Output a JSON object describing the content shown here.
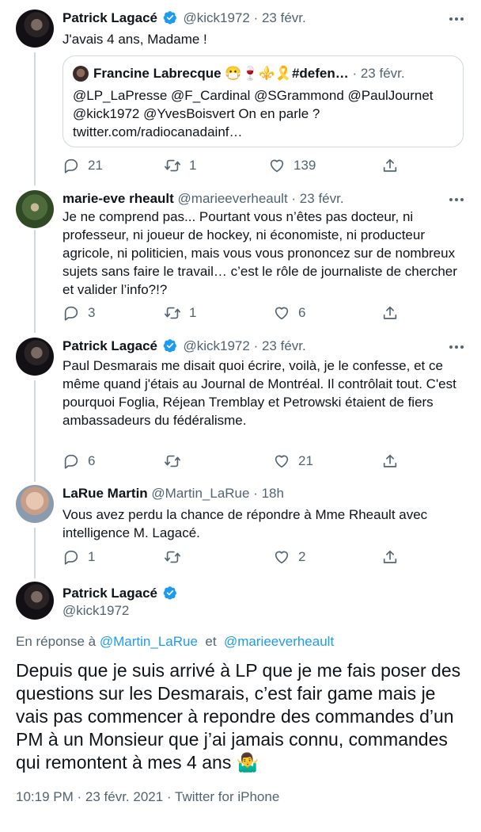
{
  "colors": {
    "accent": "#1d9bf0",
    "muted": "#536471",
    "text": "#0f1419",
    "border": "#cfd9de"
  },
  "tweets": [
    {
      "name": "Patrick Lagacé",
      "handle": "@kick1972",
      "date": "· 23 févr.",
      "verified": true,
      "text": "J'avais 4 ans, Madame !",
      "quote": {
        "name": "Francine Labrecque 😷🍷⚜️🎗️#defen…",
        "date": "· 23 févr.",
        "text": "@LP_LaPresse @F_Cardinal @SGrammond @PaulJournet @kick1972 @YvesBoisvert On en parle ? twitter.com/radiocanadainf…"
      },
      "replies": "21",
      "retweets": "1",
      "likes": "139"
    },
    {
      "name": "marie-eve rheault",
      "handle": "@marieeverheault",
      "date": "· 23 févr.",
      "verified": false,
      "text": "Je ne comprend pas... Pourtant vous n’êtes pas docteur, ni professeur, ni joueur de hockey, ni économiste, ni producteur agricole, ni politicien, mais vous vous prononcez sur de nombreux sujets sans faire le travail… c’est le rôle de journaliste de chercher et valider l’info?!?",
      "replies": "3",
      "retweets": "1",
      "likes": "6"
    },
    {
      "name": "Patrick Lagacé",
      "handle": "@kick1972",
      "date": "· 23 févr.",
      "verified": true,
      "text": "Paul Desmarais me disait quoi écrire, voilà, je le confesse, et ce même quand j'étais au Journal de Montréal. Il contrôlait tout. C'est pourquoi Foglia, Réjean Tremblay et Petrowski étaient de fiers ambassadeurs du fédéralisme.",
      "replies": "6",
      "retweets": "",
      "likes": "21"
    },
    {
      "name": "LaRue Martin",
      "handle": "@Martin_LaRue",
      "date": "· 18h",
      "verified": false,
      "text": "Vous avez perdu la chance de répondre à Mme Rheault avec intelligence M. Lagacé.",
      "replies": "1",
      "retweets": "",
      "likes": "2"
    }
  ],
  "focus": {
    "name": "Patrick Lagacé",
    "handle": "@kick1972",
    "reply_prefix": "En réponse à",
    "reply_user1": "@Martin_LaRue",
    "reply_and": "et",
    "reply_user2": "@marieeverheault",
    "text": "Depuis que je suis arrivé à LP que je me fais poser des questions sur les Desmarais, c’est fair game mais je vais pas commencer à repondre des commandes d’un PM à un Monsieur que j’ai jamais connu, commandes qui remontent à mes 4 ans 🤷‍♂️",
    "time": "10:19 PM",
    "date": "· 23 févr. 2021",
    "source": "· Twitter for iPhone"
  }
}
